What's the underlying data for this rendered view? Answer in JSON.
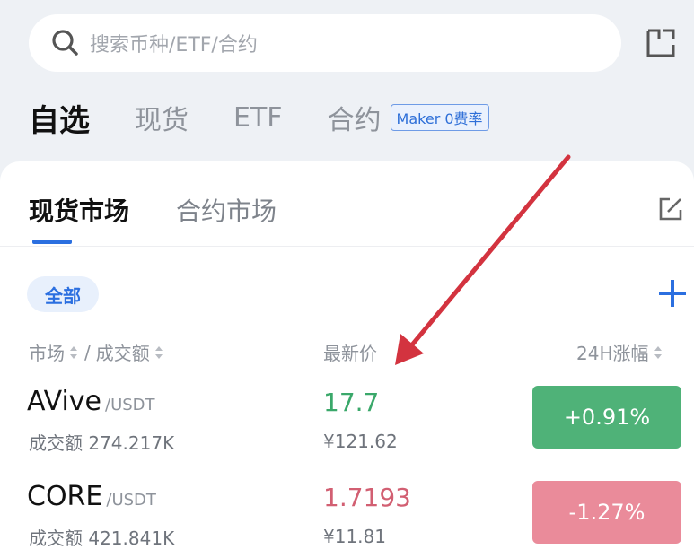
{
  "search": {
    "placeholder": "搜索币种/ETF/合约",
    "icon": "search-icon"
  },
  "header": {
    "scan_icon": "scan-icon"
  },
  "top_tabs": [
    {
      "label": "自选",
      "active": true
    },
    {
      "label": "现货",
      "active": false
    },
    {
      "label": "ETF",
      "active": false
    },
    {
      "label": "合约",
      "active": false
    }
  ],
  "maker_badge": "Maker 0费率",
  "sub_tabs": [
    {
      "label": "现货市场",
      "active": true
    },
    {
      "label": "合约市场",
      "active": false
    }
  ],
  "filter": {
    "label": "全部"
  },
  "columns": {
    "market": "市场",
    "separator": "/",
    "volume": "成交额",
    "last_price": "最新价",
    "change": "24H涨幅"
  },
  "rows": [
    {
      "base": "AVive",
      "quote": "/USDT",
      "volume_label": "成交额",
      "volume": "274.217K",
      "price": "17.7",
      "fiat": "¥121.62",
      "change": "+0.91%",
      "direction": "up"
    },
    {
      "base": "CORE",
      "quote": "/USDT",
      "volume_label": "成交额",
      "volume": "421.841K",
      "price": "1.7193",
      "fiat": "¥11.81",
      "change": "-1.27%",
      "direction": "down"
    }
  ],
  "colors": {
    "accent": "#2b6fe0",
    "up": "#4fb278",
    "down": "#ea8b9a",
    "annotation": "#d3333f"
  }
}
